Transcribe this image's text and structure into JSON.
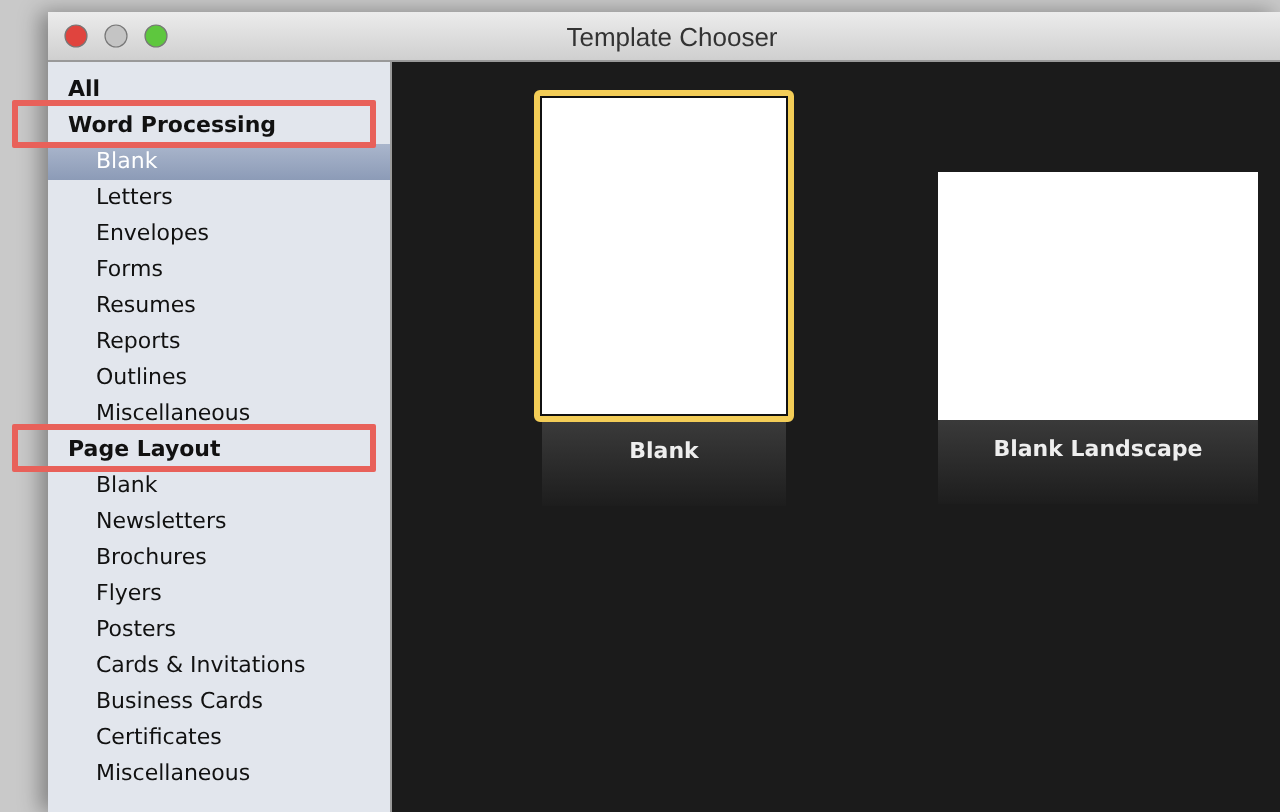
{
  "window": {
    "title": "Template Chooser"
  },
  "sidebar": {
    "items": [
      {
        "label": "All",
        "selected": false
      },
      {
        "label": "Word Processing",
        "selected": false,
        "highlighted": true,
        "children": [
          {
            "label": "Blank",
            "selected": true
          },
          {
            "label": "Letters",
            "selected": false
          },
          {
            "label": "Envelopes",
            "selected": false
          },
          {
            "label": "Forms",
            "selected": false
          },
          {
            "label": "Resumes",
            "selected": false
          },
          {
            "label": "Reports",
            "selected": false
          },
          {
            "label": "Outlines",
            "selected": false
          },
          {
            "label": "Miscellaneous",
            "selected": false
          }
        ]
      },
      {
        "label": "Page Layout",
        "selected": false,
        "highlighted": true,
        "children": [
          {
            "label": "Blank",
            "selected": false
          },
          {
            "label": "Newsletters",
            "selected": false
          },
          {
            "label": "Brochures",
            "selected": false
          },
          {
            "label": "Flyers",
            "selected": false
          },
          {
            "label": "Posters",
            "selected": false
          },
          {
            "label": "Cards & Invitations",
            "selected": false
          },
          {
            "label": "Business Cards",
            "selected": false
          },
          {
            "label": "Certificates",
            "selected": false
          },
          {
            "label": "Miscellaneous",
            "selected": false
          }
        ]
      }
    ]
  },
  "templates": [
    {
      "label": "Blank",
      "kind": "portrait",
      "selected": true
    },
    {
      "label": "Blank Landscape",
      "kind": "landscape",
      "selected": false
    }
  ]
}
